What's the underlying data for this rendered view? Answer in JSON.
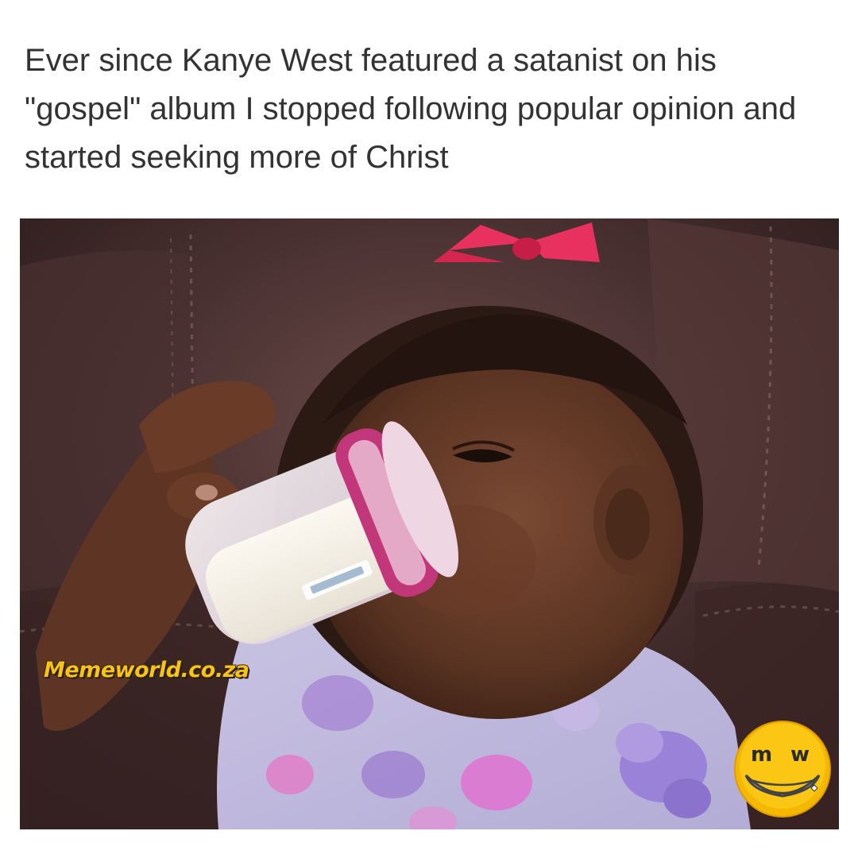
{
  "caption": "Ever since Kanye West featured a satanist on his \"gospel\" album I stopped following popular opinion and started seeking more of Christ",
  "photo": {
    "subject": "baby-drinking-from-bottle",
    "watermark": "Memeworld.co.za"
  },
  "logo": {
    "letters": "m w",
    "icon": "grinning-face-logo-icon"
  },
  "colors": {
    "caption_text": "#333333",
    "watermark": "#f7c21a",
    "logo_face": "#f5b800",
    "bow": "#e8315e",
    "bottle_cap": "#c2367a"
  }
}
